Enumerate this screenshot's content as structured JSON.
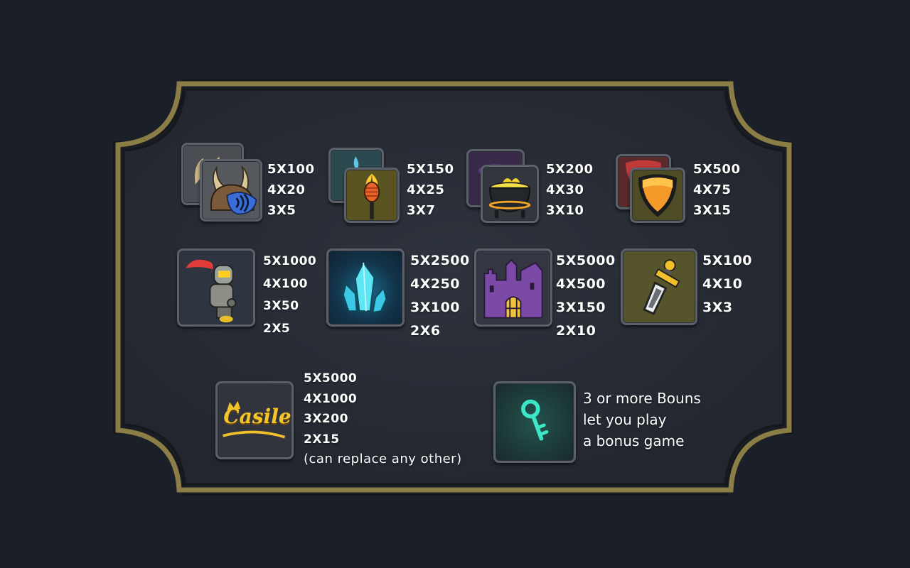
{
  "paytable": {
    "symbols": [
      {
        "icon": "viking-helmet-icon",
        "payouts": [
          "5X100",
          "4X20",
          "3X5"
        ]
      },
      {
        "icon": "torch-icon",
        "payouts": [
          "5X150",
          "4X25",
          "3X7"
        ]
      },
      {
        "icon": "cauldron-icon",
        "payouts": [
          "5X200",
          "4X30",
          "3X10"
        ]
      },
      {
        "icon": "shield-icon",
        "payouts": [
          "5X500",
          "4X75",
          "3X15"
        ]
      },
      {
        "icon": "knight-icon",
        "payouts": [
          "5X1000",
          "4X100",
          "3X50",
          "2X5"
        ]
      },
      {
        "icon": "crystal-icon",
        "payouts": [
          "5X2500",
          "4X250",
          "3X100",
          "2X6"
        ]
      },
      {
        "icon": "castle-icon",
        "payouts": [
          "5X5000",
          "4X500",
          "3X150",
          "2X10"
        ]
      },
      {
        "icon": "sword-icon",
        "payouts": [
          "5X100",
          "4X10",
          "3X3"
        ]
      }
    ],
    "wild": {
      "icon": "castle-logo-icon",
      "logo_text": "Casile",
      "payouts": [
        "5X5000",
        "4X1000",
        "3X200",
        "2X15"
      ],
      "note": "(can replace any other)"
    },
    "bonus": {
      "icon": "key-icon",
      "lines": [
        "3 or more Bouns",
        "let you play",
        "a bonus game"
      ]
    }
  },
  "colors": {
    "background": "#1b1f27",
    "panel": "#262a33",
    "frame_gold": "#8a7d45",
    "text": "#ffffff"
  }
}
